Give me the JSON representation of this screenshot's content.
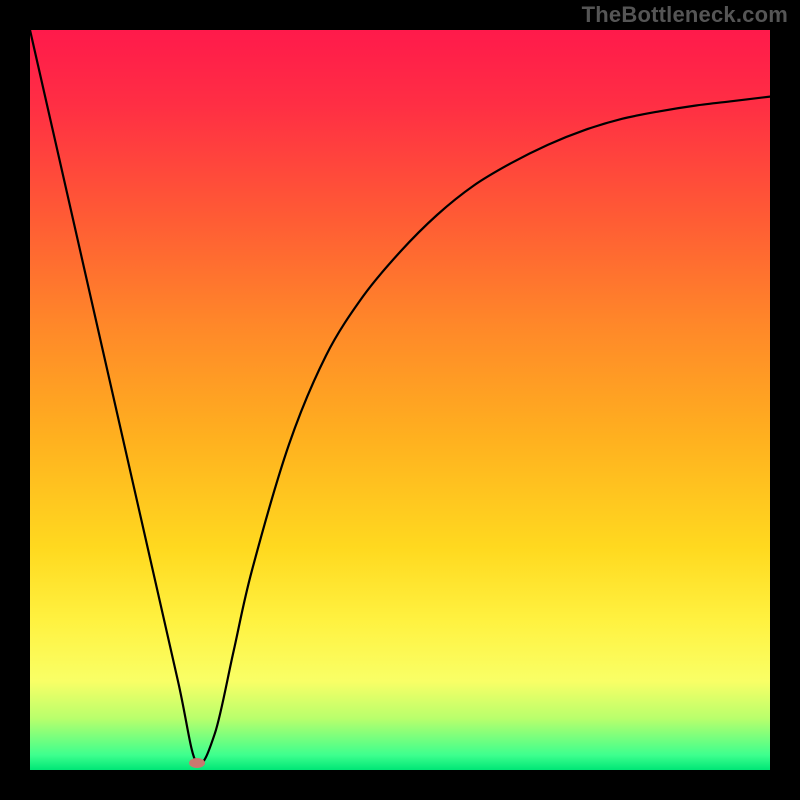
{
  "watermark": {
    "text": "TheBottleneck.com"
  },
  "chart_data": {
    "type": "line",
    "title": "",
    "xlabel": "",
    "ylabel": "",
    "xlim": [
      0,
      100
    ],
    "ylim": [
      0,
      100
    ],
    "grid": false,
    "legend": false,
    "series": [
      {
        "name": "bottleneck-curve",
        "x": [
          0,
          5,
          10,
          15,
          20,
          22.5,
          25,
          27.5,
          30,
          35,
          40,
          45,
          50,
          55,
          60,
          65,
          70,
          75,
          80,
          85,
          90,
          95,
          100
        ],
        "y": [
          100,
          78,
          56,
          34,
          12,
          1,
          5,
          16,
          27,
          44,
          56,
          64,
          70,
          75,
          79,
          82,
          84.5,
          86.5,
          88,
          89,
          89.8,
          90.4,
          91
        ]
      }
    ],
    "marker": {
      "x": 22.5,
      "y": 1,
      "label": "optimum-point"
    },
    "background_gradient_stops": [
      {
        "pos": 0,
        "color": "#ff1a4b"
      },
      {
        "pos": 25,
        "color": "#ff5a35"
      },
      {
        "pos": 55,
        "color": "#ffb01f"
      },
      {
        "pos": 80,
        "color": "#fff241"
      },
      {
        "pos": 98,
        "color": "#3dff8e"
      },
      {
        "pos": 100,
        "color": "#00e676"
      }
    ]
  }
}
